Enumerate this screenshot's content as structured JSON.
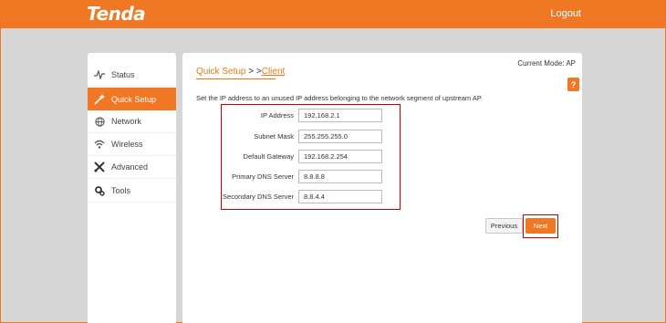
{
  "header": {
    "logo": "Tenda",
    "logout_label": "Logout"
  },
  "sidebar": {
    "items": [
      {
        "label": "Status",
        "icon": "pulse-icon"
      },
      {
        "label": "Quick Setup",
        "icon": "wand-icon",
        "active": true
      },
      {
        "label": "Network",
        "icon": "globe-icon"
      },
      {
        "label": "Wireless",
        "icon": "wifi-icon"
      },
      {
        "label": "Advanced",
        "icon": "tools-icon"
      },
      {
        "label": "Tools",
        "icon": "gears-icon"
      }
    ]
  },
  "main": {
    "current_mode": "Current Mode: AP",
    "breadcrumb": {
      "parent": "Quick Setup",
      "separator": " > >",
      "current": "Client"
    },
    "help_label": "?",
    "description": "Set the IP address to an unused IP address belonging to the network segment of upstream AP.",
    "fields": [
      {
        "label": "IP Address",
        "value": "192.168.2.1"
      },
      {
        "label": "Subnet Mask",
        "value": "255.255.255.0"
      },
      {
        "label": "Default Gateway",
        "value": "192.168.2.254"
      },
      {
        "label": "Primary DNS Server",
        "value": "8.8.8.8"
      },
      {
        "label": "Secondary DNS Server",
        "value": "8.8.4.4"
      }
    ],
    "previous_label": "Previous",
    "next_label": "Next"
  },
  "colors": {
    "accent": "#f07824",
    "highlight_border": "#c00000",
    "background": "#d6d6d6"
  }
}
